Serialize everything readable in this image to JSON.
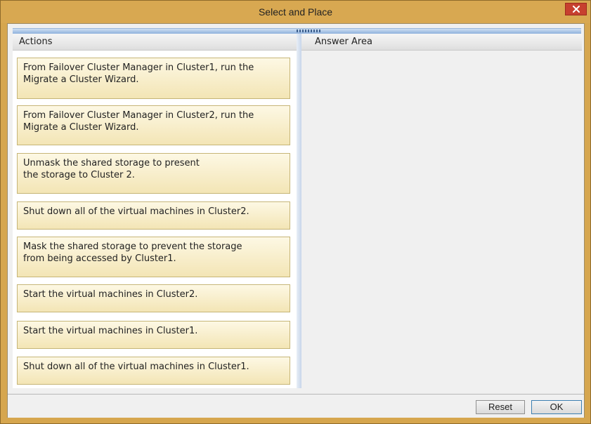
{
  "window": {
    "title": "Select and Place"
  },
  "actions_pane": {
    "header": "Actions",
    "items": [
      "From Failover Cluster Manager in Cluster1, run the\nMigrate a Cluster Wizard.",
      "From Failover Cluster Manager in Cluster2, run the\nMigrate a Cluster Wizard.",
      "Unmask the shared storage to present\nthe storage to Cluster 2.",
      "Shut down all of the virtual machines in Cluster2.",
      "Mask the shared storage to prevent the storage\nfrom being accessed by Cluster1.",
      "Start the virtual machines in Cluster2.",
      "Start the virtual machines in Cluster1.",
      "Shut down all of the virtual machines in Cluster1."
    ]
  },
  "answer_pane": {
    "header": "Answer Area"
  },
  "buttons": {
    "reset": "Reset",
    "ok": "OK"
  },
  "icons": {
    "close": "close-icon",
    "splitter_grip": "grip-icon"
  }
}
